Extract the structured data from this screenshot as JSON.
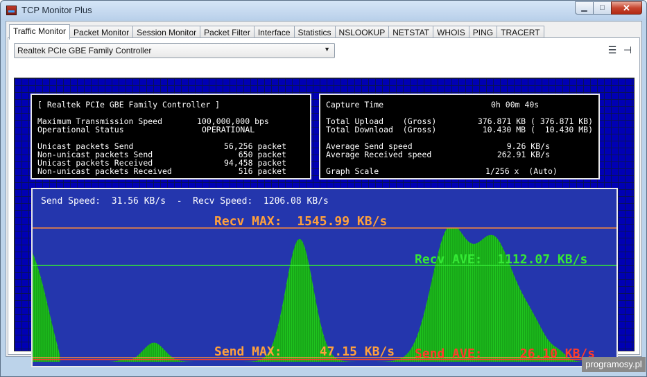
{
  "window": {
    "title": "TCP Monitor Plus",
    "min_label": "▁",
    "max_label": "□",
    "close_label": "✕"
  },
  "tabs": [
    {
      "label": "Traffic Monitor"
    },
    {
      "label": "Packet Monitor"
    },
    {
      "label": "Session Monitor"
    },
    {
      "label": "Packet Filter"
    },
    {
      "label": "Interface"
    },
    {
      "label": "Statistics"
    },
    {
      "label": "NSLOOKUP"
    },
    {
      "label": "NETSTAT"
    },
    {
      "label": "WHOIS"
    },
    {
      "label": "PING"
    },
    {
      "label": "TRACERT"
    }
  ],
  "adapter": {
    "selected": "Realtek PCIe GBE Family Controller"
  },
  "left_panel": {
    "title": "[ Realtek PCIe GBE Family Controller ]",
    "max_speed_label": "Maximum Transmission Speed",
    "max_speed_value": "100,000,000 bps",
    "op_status_label": "Operational Status",
    "op_status_value": "OPERATIONAL",
    "rows": [
      {
        "label": "Unicast packets Send",
        "value": "56,256 packet"
      },
      {
        "label": "Non-unicast packets Send",
        "value": "650 packet"
      },
      {
        "label": "Unicast packets Received",
        "value": "94,458 packet"
      },
      {
        "label": "Non-unicast packets Received",
        "value": "516 packet"
      }
    ]
  },
  "right_panel": {
    "capture_label": "Capture Time",
    "capture_value": "0h 00m 40s",
    "upload_label": "Total Upload    (Gross)",
    "upload_value": "376.871 KB ( 376.871 KB)",
    "download_label": "Total Download  (Gross)",
    "download_value": "10.430 MB (  10.430 MB)",
    "avg_send_label": "Average Send speed",
    "avg_send_value": "9.26 KB/s",
    "avg_recv_label": "Average Received speed",
    "avg_recv_value": "262.91 KB/s",
    "scale_label": "Graph Scale",
    "scale_value": "1/256 x  (Auto)"
  },
  "graph": {
    "send_speed_label": "Send Speed:",
    "send_speed_value": "31.56 KB/s",
    "separator": "-",
    "recv_speed_label": "Recv Speed:",
    "recv_speed_value": "1206.08 KB/s",
    "recv_max_label": "Recv MAX:",
    "recv_max_value": "1545.99 KB/s",
    "recv_ave_label": "Recv AVE:",
    "recv_ave_value": "1112.07 KB/s",
    "send_max_label": "Send MAX:",
    "send_max_value": "47.15 KB/s",
    "send_ave_label": "Send AVE:",
    "send_ave_value": "26.10 KB/s",
    "recv_max": 1545.99,
    "recv_ave": 1112.07,
    "send_max": 47.15,
    "send_ave": 26.1,
    "colors": {
      "background": "#2436ad",
      "recv_fill": "#1fc41f",
      "recv_max_line": "#ff8a3a",
      "recv_ave_line": "#35e835",
      "send_line": "#ff3a2a"
    }
  },
  "watermark": "programosy.pl"
}
